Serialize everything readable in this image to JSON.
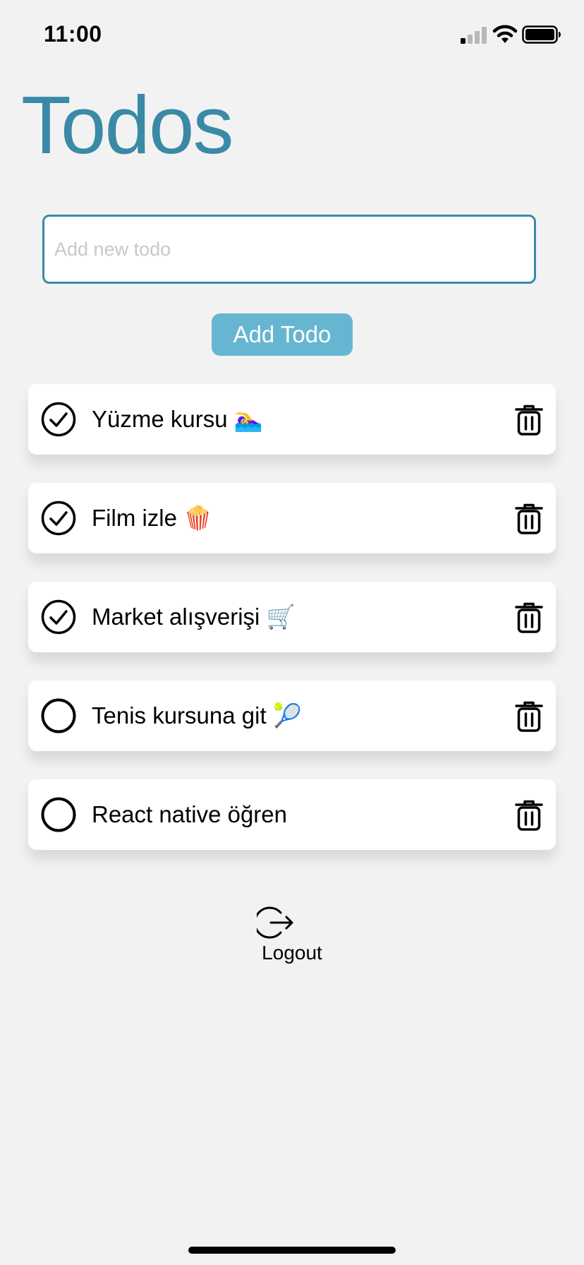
{
  "status_bar": {
    "time": "11:00"
  },
  "header": {
    "title": "Todos"
  },
  "new_todo": {
    "placeholder": "Add new todo",
    "value": "",
    "button_label": "Add Todo"
  },
  "todos": [
    {
      "label": "Yüzme kursu 🏊‍♀️",
      "completed": true
    },
    {
      "label": "Film izle 🍿",
      "completed": true
    },
    {
      "label": "Market alışverişi 🛒",
      "completed": true
    },
    {
      "label": "Tenis kursuna git 🎾",
      "completed": false
    },
    {
      "label": "React native öğren",
      "completed": false
    }
  ],
  "footer": {
    "logout_label": "Logout"
  },
  "colors": {
    "accent": "#3a8aa6",
    "button": "#67b6d1",
    "background": "#f2f2f2"
  },
  "icons": {
    "completed": "check-circle-icon",
    "pending": "circle-icon",
    "delete": "trash-icon",
    "logout": "logout-icon"
  }
}
